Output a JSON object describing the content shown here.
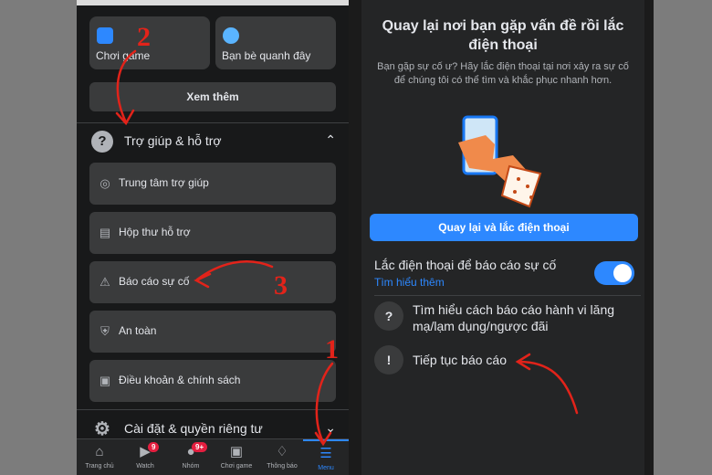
{
  "left": {
    "tiles": [
      {
        "label": "Chơi game",
        "icon": "game-icon"
      },
      {
        "label": "Bạn bè quanh đây",
        "icon": "nearby-friends-icon"
      }
    ],
    "see_more": "Xem thêm",
    "help_section": {
      "label": "Trợ giúp & hỗ trợ",
      "icon": "question-icon",
      "chevron": "^"
    },
    "help_items": [
      {
        "label": "Trung tâm trợ giúp",
        "icon": "lifebuoy-icon"
      },
      {
        "label": "Hộp thư hỗ trợ",
        "icon": "inbox-icon"
      },
      {
        "label": "Báo cáo sự cố",
        "icon": "warning-icon"
      },
      {
        "label": "An toàn",
        "icon": "shield-icon"
      },
      {
        "label": "Điều khoản & chính sách",
        "icon": "document-icon"
      }
    ],
    "settings_section": {
      "label": "Cài đặt & quyền riêng tư",
      "icon": "gear-icon",
      "chevron": "v"
    },
    "tabbar": [
      {
        "label": "Trang chủ",
        "icon": "home-icon",
        "badge": ""
      },
      {
        "label": "Watch",
        "icon": "watch-icon",
        "badge": "9"
      },
      {
        "label": "Nhóm",
        "icon": "groups-icon",
        "badge": "9+"
      },
      {
        "label": "Chơi game",
        "icon": "gaming-icon",
        "badge": ""
      },
      {
        "label": "Thông báo",
        "icon": "bell-icon",
        "badge": ""
      },
      {
        "label": "Menu",
        "icon": "menu-icon",
        "badge": ""
      }
    ]
  },
  "right": {
    "title": "Quay lại nơi bạn gặp vấn đề rồi lắc điện thoại",
    "description": "Bạn gặp sự cố ư? Hãy lắc điện thoại tại nơi xảy ra sự cố để chúng tôi có thể tìm và khắc phục nhanh hơn.",
    "primary_button": "Quay lại và lắc điện thoại",
    "toggle_label": "Lắc điện thoại để báo cáo sự cố",
    "toggle_link": "Tìm hiểu thêm",
    "toggle_on": true,
    "rows": [
      {
        "label": "Tìm hiểu cách báo cáo hành vi lăng mạ/lạm dụng/ngược đãi",
        "icon": "question-icon"
      },
      {
        "label": "Tiếp tục báo cáo",
        "icon": "exclamation-icon"
      }
    ]
  },
  "annotations": {
    "numbers": [
      "2",
      "3",
      "1"
    ],
    "color": "#e2231a"
  },
  "colors": {
    "accent": "#2d88ff",
    "badge": "#e41e3f"
  }
}
